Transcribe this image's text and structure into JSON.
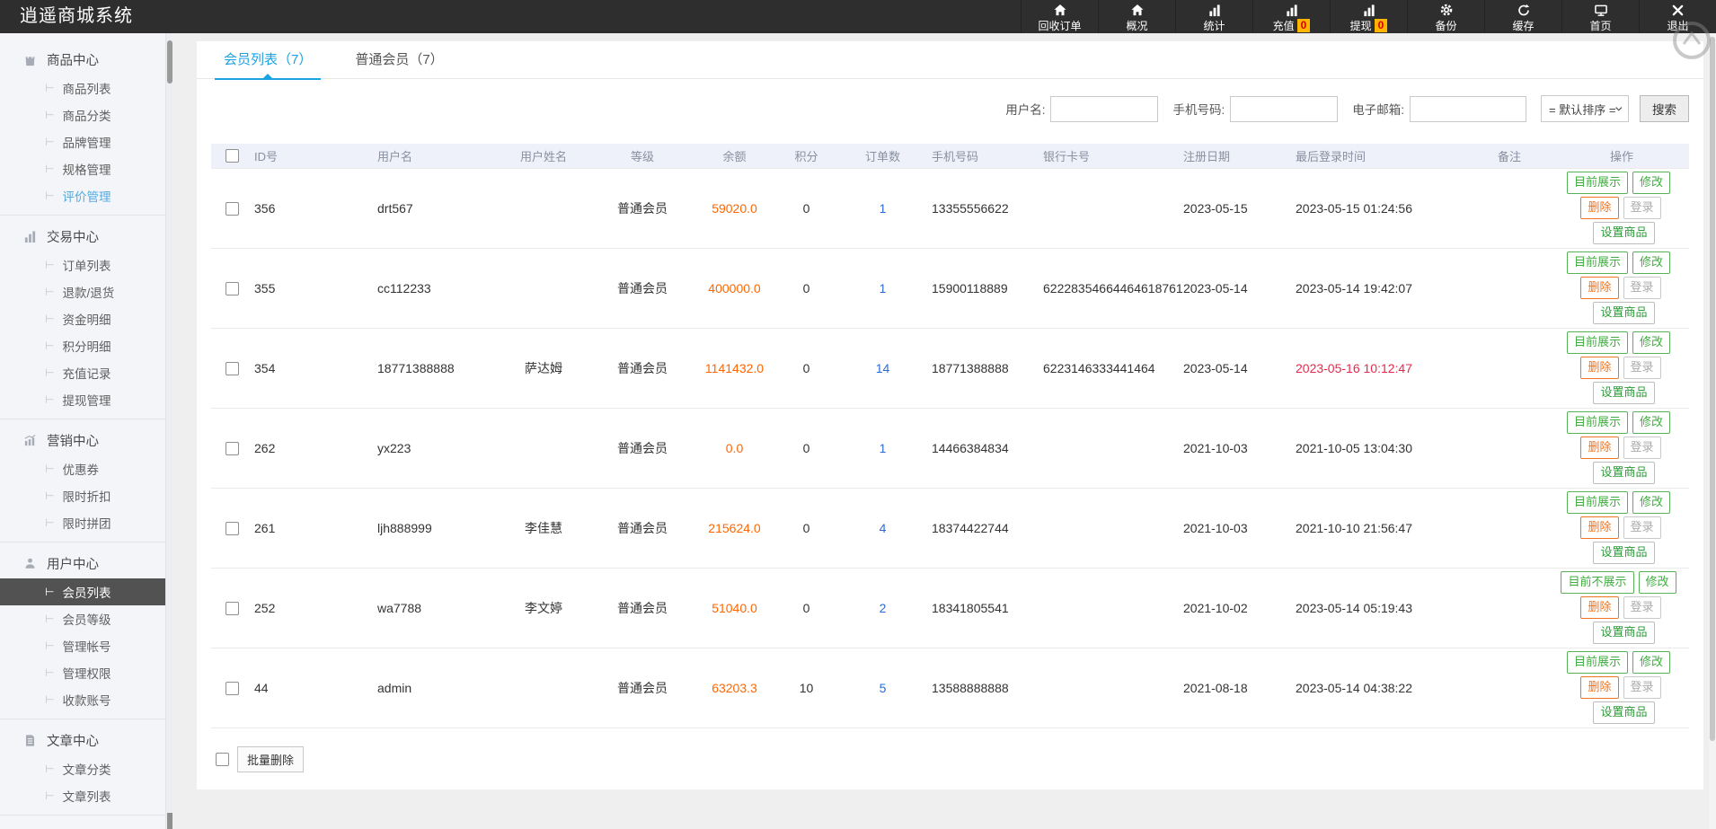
{
  "app": {
    "title": "逍遥商城系统"
  },
  "topbar": {
    "items": [
      {
        "label": "回收订单",
        "icon": "home-icon"
      },
      {
        "label": "概况",
        "icon": "home-icon"
      },
      {
        "label": "统计",
        "icon": "bar-chart-icon"
      },
      {
        "label": "充值",
        "icon": "bar-chart-icon",
        "badge": "0"
      },
      {
        "label": "提现",
        "icon": "bar-chart-icon",
        "badge": "0"
      },
      {
        "label": "备份",
        "icon": "gear-icon"
      },
      {
        "label": "缓存",
        "icon": "refresh-icon"
      },
      {
        "label": "首页",
        "icon": "monitor-icon"
      },
      {
        "label": "退出",
        "icon": "close-icon"
      }
    ]
  },
  "sidebar": {
    "groups": [
      {
        "label": "商品中心",
        "icon": "shopping-bag-icon",
        "items": [
          {
            "label": "商品列表"
          },
          {
            "label": "商品分类"
          },
          {
            "label": "品牌管理"
          },
          {
            "label": "规格管理"
          },
          {
            "label": "评价管理",
            "state": "highlight"
          }
        ]
      },
      {
        "label": "交易中心",
        "icon": "bar-chart-icon",
        "items": [
          {
            "label": "订单列表"
          },
          {
            "label": "退款/退货"
          },
          {
            "label": "资金明细"
          },
          {
            "label": "积分明细"
          },
          {
            "label": "充值记录"
          },
          {
            "label": "提现管理"
          }
        ]
      },
      {
        "label": "营销中心",
        "icon": "trend-chart-icon",
        "items": [
          {
            "label": "优惠券"
          },
          {
            "label": "限时折扣"
          },
          {
            "label": "限时拼团"
          }
        ]
      },
      {
        "label": "用户中心",
        "icon": "user-icon",
        "items": [
          {
            "label": "会员列表",
            "state": "active"
          },
          {
            "label": "会员等级"
          },
          {
            "label": "管理帐号"
          },
          {
            "label": "管理权限"
          },
          {
            "label": "收款账号"
          }
        ]
      },
      {
        "label": "文章中心",
        "icon": "document-icon",
        "items": [
          {
            "label": "文章分类"
          },
          {
            "label": "文章列表"
          }
        ]
      }
    ]
  },
  "content": {
    "tabs": [
      {
        "label": "会员列表（7）",
        "active": true
      },
      {
        "label": "普通会员（7）",
        "active": false
      }
    ],
    "search": {
      "username_label": "用户名:",
      "phone_label": "手机号码:",
      "email_label": "电子邮箱:",
      "sort_value": "= 默认排序 =",
      "search_button": "搜索"
    },
    "table_headers": [
      "ID号",
      "用户名",
      "用户姓名",
      "等级",
      "余额",
      "积分",
      "订单数",
      "手机号码",
      "银行卡号",
      "注册日期",
      "最后登录时间",
      "备注",
      "操作"
    ]
  },
  "members": {
    "actions": {
      "edit": "修改",
      "delete": "删除",
      "login": "登录",
      "set_goods": "设置商品"
    },
    "rows": [
      {
        "id": "356",
        "username": "drt567",
        "realname": "",
        "level": "普通会员",
        "balance": "59020.0",
        "points": "0",
        "orders": "1",
        "phone": "13355556622",
        "bank": "",
        "reg": "2023-05-15",
        "last": "2023-05-15 01:24:56",
        "last_red": false,
        "note": "",
        "show_btn": "目前展示"
      },
      {
        "id": "355",
        "username": "cc112233",
        "realname": "",
        "level": "普通会员",
        "balance": "400000.0",
        "points": "0",
        "orders": "1",
        "phone": "15900118889",
        "bank": "62228354664464618761",
        "reg": "2023-05-14",
        "last": "2023-05-14 19:42:07",
        "last_red": false,
        "note": "",
        "show_btn": "目前展示"
      },
      {
        "id": "354",
        "username": "18771388888",
        "realname": "萨达姆",
        "level": "普通会员",
        "balance": "1141432.0",
        "points": "0",
        "orders": "14",
        "phone": "18771388888",
        "bank": "6223146333441464",
        "reg": "2023-05-14",
        "last": "2023-05-16 10:12:47",
        "last_red": true,
        "note": "",
        "show_btn": "目前展示"
      },
      {
        "id": "262",
        "username": "yx223",
        "realname": "",
        "level": "普通会员",
        "balance": "0.0",
        "points": "0",
        "orders": "1",
        "phone": "14466384834",
        "bank": "",
        "reg": "2021-10-03",
        "last": "2021-10-05 13:04:30",
        "last_red": false,
        "note": "",
        "show_btn": "目前展示"
      },
      {
        "id": "261",
        "username": "ljh888999",
        "realname": "李佳慧",
        "level": "普通会员",
        "balance": "215624.0",
        "points": "0",
        "orders": "4",
        "phone": "18374422744",
        "bank": "",
        "reg": "2021-10-03",
        "last": "2021-10-10 21:56:47",
        "last_red": false,
        "note": "",
        "show_btn": "目前展示"
      },
      {
        "id": "252",
        "username": "wa7788",
        "realname": "李文婷",
        "level": "普通会员",
        "balance": "51040.0",
        "points": "0",
        "orders": "2",
        "phone": "18341805541",
        "bank": "",
        "reg": "2021-10-02",
        "last": "2023-05-14 05:19:43",
        "last_red": false,
        "note": "",
        "show_btn": "目前不展示"
      },
      {
        "id": "44",
        "username": "admin",
        "realname": "",
        "level": "普通会员",
        "balance": "63203.3",
        "points": "10",
        "orders": "5",
        "phone": "13588888888",
        "bank": "",
        "reg": "2021-08-18",
        "last": "2023-05-14 04:38:22",
        "last_red": false,
        "note": "",
        "show_btn": "目前展示"
      }
    ]
  },
  "footer": {
    "bulk_delete_label": "批量删除"
  },
  "colors": {
    "topbar_bg": "#2e2e2e",
    "accent_blue": "#1ba2e2",
    "balance_orange": "#ff6600",
    "orders_blue": "#2b6cd4",
    "late_login_red": "#e6294b",
    "button_green": "#3fae3f",
    "button_orange": "#ee7521",
    "badge_bg": "#ffb400",
    "badge_text": "#d40000",
    "table_header_bg": "#eef1f9",
    "sidebar_bg": "#f3f5f9",
    "active_item_bg": "#525252"
  }
}
